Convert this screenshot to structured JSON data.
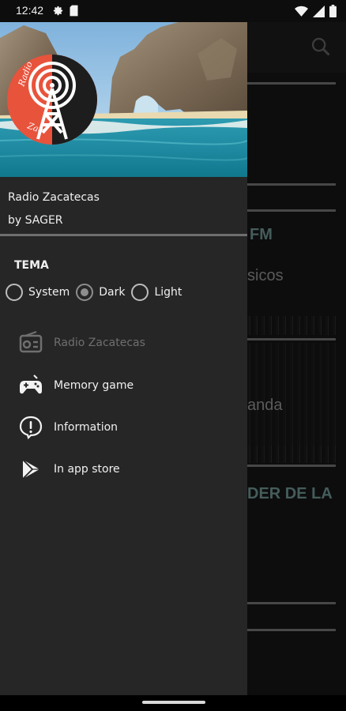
{
  "status_bar": {
    "time": "12:42",
    "left_icons": [
      "settings-icon",
      "sd-card-icon"
    ],
    "right_icons": [
      "wifi-icon",
      "signal-icon",
      "battery-icon"
    ]
  },
  "background": {
    "texts": [
      "FM",
      "sicos",
      "anda",
      "DER DE LA"
    ]
  },
  "drawer": {
    "header": {
      "logo_text_top": "Radio",
      "logo_text_bottom": "Zac",
      "title": "Radio Zacatecas",
      "subtitle": "by SAGER"
    },
    "theme": {
      "label": "TEMA",
      "options": [
        {
          "label": "System",
          "checked": false
        },
        {
          "label": "Dark",
          "checked": true
        },
        {
          "label": "Light",
          "checked": false
        }
      ]
    },
    "items": [
      {
        "label": "Radio Zacatecas",
        "icon": "radio-icon",
        "enabled": false
      },
      {
        "label": "Memory game",
        "icon": "gamepad-icon",
        "enabled": true
      },
      {
        "label": "Information",
        "icon": "info-icon",
        "enabled": true
      },
      {
        "label": "In app store",
        "icon": "play-store-icon",
        "enabled": true
      }
    ]
  },
  "colors": {
    "drawer_bg": "#262626",
    "logo_red": "#e8533c",
    "accent_teal": "#6a8f8c"
  }
}
